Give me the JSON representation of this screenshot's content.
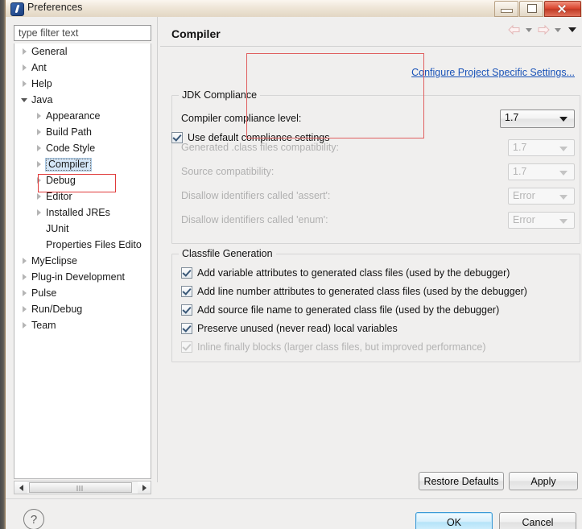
{
  "window": {
    "title": "Preferences",
    "icon": "eclipse-icon",
    "controls": {
      "minimize": "Minimize",
      "maximize": "Maximize",
      "close": "Close"
    }
  },
  "sidebar": {
    "filter_placeholder": "type filter text",
    "filter_value": "",
    "items": [
      {
        "label": "General",
        "level": 0,
        "state": "collapsed"
      },
      {
        "label": "Ant",
        "level": 0,
        "state": "collapsed"
      },
      {
        "label": "Help",
        "level": 0,
        "state": "collapsed"
      },
      {
        "label": "Java",
        "level": 0,
        "state": "expanded"
      },
      {
        "label": "Appearance",
        "level": 1,
        "state": "collapsed"
      },
      {
        "label": "Build Path",
        "level": 1,
        "state": "collapsed"
      },
      {
        "label": "Code Style",
        "level": 1,
        "state": "collapsed"
      },
      {
        "label": "Compiler",
        "level": 1,
        "state": "collapsed",
        "selected": true,
        "highlighted": true
      },
      {
        "label": "Debug",
        "level": 1,
        "state": "collapsed"
      },
      {
        "label": "Editor",
        "level": 1,
        "state": "collapsed"
      },
      {
        "label": "Installed JREs",
        "level": 1,
        "state": "collapsed"
      },
      {
        "label": "JUnit",
        "level": 1,
        "state": "leaf"
      },
      {
        "label": "Properties Files Edito",
        "level": 1,
        "state": "leaf"
      },
      {
        "label": "MyEclipse",
        "level": 0,
        "state": "collapsed"
      },
      {
        "label": "Plug-in Development",
        "level": 0,
        "state": "collapsed"
      },
      {
        "label": "Pulse",
        "level": 0,
        "state": "collapsed"
      },
      {
        "label": "Run/Debug",
        "level": 0,
        "state": "collapsed"
      },
      {
        "label": "Team",
        "level": 0,
        "state": "collapsed"
      }
    ]
  },
  "content": {
    "title": "Compiler",
    "configure_link": "Configure Project Specific Settings...",
    "toolbar": {
      "back": "back-icon",
      "back_menu": "back-dropdown",
      "forward": "forward-icon",
      "forward_menu": "forward-dropdown",
      "view_menu": "view-menu"
    },
    "jdk_group": {
      "title": "JDK Compliance",
      "compliance_level_label": "Compiler compliance level:",
      "compliance_level_value": "1.7",
      "use_default_label": "Use default compliance settings",
      "use_default_checked": true,
      "rows": [
        {
          "label": "Generated .class files compatibility:",
          "value": "1.7",
          "disabled": true
        },
        {
          "label": "Source compatibility:",
          "value": "1.7",
          "disabled": true
        },
        {
          "label": "Disallow identifiers called 'assert':",
          "value": "Error",
          "disabled": true
        },
        {
          "label": "Disallow identifiers called 'enum':",
          "value": "Error",
          "disabled": true
        }
      ]
    },
    "classfile_group": {
      "title": "Classfile Generation",
      "checkboxes": [
        {
          "label": "Add variable attributes to generated class files (used by the debugger)",
          "checked": true,
          "disabled": false
        },
        {
          "label": "Add line number attributes to generated class files (used by the debugger)",
          "checked": true,
          "disabled": false
        },
        {
          "label": "Add source file name to generated class file (used by the debugger)",
          "checked": true,
          "disabled": false
        },
        {
          "label": "Preserve unused (never read) local variables",
          "checked": true,
          "disabled": false
        },
        {
          "label": "Inline finally blocks (larger class files, but improved performance)",
          "checked": true,
          "disabled": true
        }
      ]
    }
  },
  "buttons": {
    "restore_defaults": "Restore Defaults",
    "apply": "Apply",
    "ok": "OK",
    "cancel": "Cancel",
    "help": "?"
  },
  "colors": {
    "link": "#1a53b8",
    "annotation_red": "#e03a3a",
    "selection_blue": "#d4e6f7",
    "ok_focus_blue": "#3c9ad6",
    "close_red": "#d9452e"
  }
}
